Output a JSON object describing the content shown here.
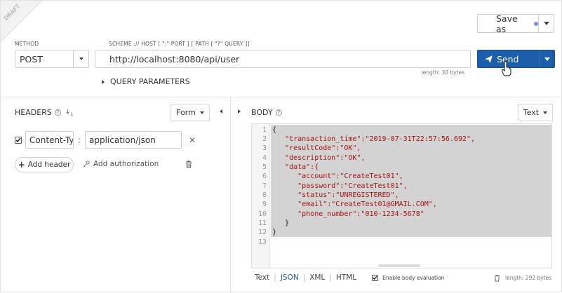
{
  "draft_label": "DRAFT",
  "toolbar": {
    "save_as_label": "Save as",
    "save_dot_color": "#7d8ce0"
  },
  "request": {
    "method_label": "METHOD",
    "method": "POST",
    "url_label": "SCHEME :// HOST [ \":\" PORT ] [ PATH [ \"?\" QUERY ]]",
    "url": "http://localhost:8080/api/user",
    "url_length": "length: 30 bytes",
    "send_label": "Send",
    "send_color": "#1c5ea9",
    "query_params_label": "QUERY PARAMETERS"
  },
  "headers": {
    "title": "HEADERS",
    "help": "?",
    "form_label": "Form",
    "items": [
      {
        "name": "Content-Type",
        "value": "application/json",
        "enabled": true
      }
    ],
    "add_header_label": "Add header",
    "add_auth_label": "Add authorization"
  },
  "body": {
    "title": "BODY",
    "help": "?",
    "text_label": "Text",
    "lines": [
      "{",
      "   \"transaction_time\":\"2019-07-31T22:57:56.692\",",
      "   \"resultCode\":\"OK\",",
      "   \"description\":\"OK\",",
      "   \"data\":{",
      "      \"account\":\"CreateTest01\",",
      "      \"password\":\"CreateTest01\",",
      "      \"status\":\"UNREGISTERED\",",
      "      \"email\":\"CreateTest01@GMAIL.COM\",",
      "      \"phone_number\":\"010-1234-5678\"",
      "   }",
      "}",
      ""
    ],
    "line_numbers": [
      "1",
      "2",
      "3",
      "4",
      "5",
      "6",
      "7",
      "8",
      "9",
      "10",
      "11",
      "12",
      "13"
    ],
    "formats": {
      "text": "Text",
      "json": "JSON",
      "xml": "XML",
      "html": "HTML",
      "active": "JSON"
    },
    "enable_eval_label": "Enable body evaluation",
    "length": "length: 292 bytes"
  }
}
